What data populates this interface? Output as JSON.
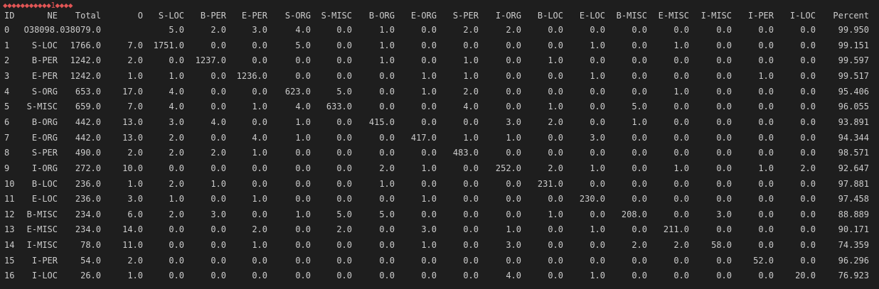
{
  "terminal": {
    "garbled_line": "◆◆◆◆◆◆◆◆◆◆◆1◆◆◆◆",
    "headers": [
      "ID",
      "NE",
      "Total",
      "O",
      "S-LOC",
      "B-PER",
      "E-PER",
      "S-ORG",
      "S-MISC",
      "B-ORG",
      "E-ORG",
      "S-PER",
      "I-ORG",
      "B-LOC",
      "E-LOC",
      "B-MISC",
      "E-MISC",
      "I-MISC",
      "I-PER",
      "I-LOC",
      "Percent"
    ],
    "rows": [
      [
        "0",
        "",
        "O38098.038079.0",
        "",
        "5.0",
        "2.0",
        "3.0",
        "4.0",
        "0.0",
        "1.0",
        "0.0",
        "2.0",
        "2.0",
        "0.0",
        "0.0",
        "0.0",
        "0.0",
        "0.0",
        "0.0",
        "0.0",
        "99.950"
      ],
      [
        "1",
        "S-LOC",
        "1766.0",
        "7.0",
        "1751.0",
        "0.0",
        "0.0",
        "5.0",
        "0.0",
        "1.0",
        "0.0",
        "0.0",
        "0.0",
        "0.0",
        "1.0",
        "0.0",
        "1.0",
        "0.0",
        "0.0",
        "0.0",
        "99.151"
      ],
      [
        "2",
        "B-PER",
        "1242.0",
        "2.0",
        "0.0",
        "1237.0",
        "0.0",
        "0.0",
        "0.0",
        "1.0",
        "0.0",
        "1.0",
        "0.0",
        "1.0",
        "0.0",
        "0.0",
        "0.0",
        "0.0",
        "0.0",
        "0.0",
        "99.597"
      ],
      [
        "3",
        "E-PER",
        "1242.0",
        "1.0",
        "1.0",
        "0.0",
        "1236.0",
        "0.0",
        "0.0",
        "0.0",
        "1.0",
        "1.0",
        "0.0",
        "0.0",
        "1.0",
        "0.0",
        "0.0",
        "0.0",
        "1.0",
        "0.0",
        "99.517"
      ],
      [
        "4",
        "S-ORG",
        "653.0",
        "17.0",
        "4.0",
        "0.0",
        "0.0",
        "623.0",
        "5.0",
        "0.0",
        "1.0",
        "2.0",
        "0.0",
        "0.0",
        "0.0",
        "0.0",
        "1.0",
        "0.0",
        "0.0",
        "0.0",
        "95.406"
      ],
      [
        "5",
        "S-MISC",
        "659.0",
        "7.0",
        "4.0",
        "0.0",
        "1.0",
        "4.0",
        "633.0",
        "0.0",
        "0.0",
        "4.0",
        "0.0",
        "1.0",
        "0.0",
        "5.0",
        "0.0",
        "0.0",
        "0.0",
        "0.0",
        "96.055"
      ],
      [
        "6",
        "B-ORG",
        "442.0",
        "13.0",
        "3.0",
        "4.0",
        "0.0",
        "1.0",
        "0.0",
        "415.0",
        "0.0",
        "0.0",
        "3.0",
        "2.0",
        "0.0",
        "1.0",
        "0.0",
        "0.0",
        "0.0",
        "0.0",
        "93.891"
      ],
      [
        "7",
        "E-ORG",
        "442.0",
        "13.0",
        "2.0",
        "0.0",
        "4.0",
        "1.0",
        "0.0",
        "0.0",
        "417.0",
        "1.0",
        "1.0",
        "0.0",
        "3.0",
        "0.0",
        "0.0",
        "0.0",
        "0.0",
        "0.0",
        "94.344"
      ],
      [
        "8",
        "S-PER",
        "490.0",
        "2.0",
        "2.0",
        "2.0",
        "1.0",
        "0.0",
        "0.0",
        "0.0",
        "0.0",
        "483.0",
        "0.0",
        "0.0",
        "0.0",
        "0.0",
        "0.0",
        "0.0",
        "0.0",
        "0.0",
        "98.571"
      ],
      [
        "9",
        "I-ORG",
        "272.0",
        "10.0",
        "0.0",
        "0.0",
        "0.0",
        "0.0",
        "0.0",
        "2.0",
        "1.0",
        "0.0",
        "252.0",
        "2.0",
        "1.0",
        "0.0",
        "1.0",
        "0.0",
        "1.0",
        "2.0",
        "92.647"
      ],
      [
        "10",
        "B-LOC",
        "236.0",
        "1.0",
        "2.0",
        "1.0",
        "0.0",
        "0.0",
        "0.0",
        "1.0",
        "0.0",
        "0.0",
        "0.0",
        "231.0",
        "0.0",
        "0.0",
        "0.0",
        "0.0",
        "0.0",
        "0.0",
        "97.881"
      ],
      [
        "11",
        "E-LOC",
        "236.0",
        "3.0",
        "1.0",
        "0.0",
        "1.0",
        "0.0",
        "0.0",
        "0.0",
        "1.0",
        "0.0",
        "0.0",
        "0.0",
        "230.0",
        "0.0",
        "0.0",
        "0.0",
        "0.0",
        "0.0",
        "97.458"
      ],
      [
        "12",
        "B-MISC",
        "234.0",
        "6.0",
        "2.0",
        "3.0",
        "0.0",
        "1.0",
        "5.0",
        "5.0",
        "0.0",
        "0.0",
        "0.0",
        "1.0",
        "0.0",
        "208.0",
        "0.0",
        "3.0",
        "0.0",
        "0.0",
        "88.889"
      ],
      [
        "13",
        "E-MISC",
        "234.0",
        "14.0",
        "0.0",
        "0.0",
        "2.0",
        "0.0",
        "2.0",
        "0.0",
        "3.0",
        "0.0",
        "1.0",
        "0.0",
        "1.0",
        "0.0",
        "211.0",
        "0.0",
        "0.0",
        "0.0",
        "90.171"
      ],
      [
        "14",
        "I-MISC",
        "78.0",
        "11.0",
        "0.0",
        "0.0",
        "1.0",
        "0.0",
        "0.0",
        "0.0",
        "1.0",
        "0.0",
        "3.0",
        "0.0",
        "0.0",
        "2.0",
        "2.0",
        "58.0",
        "0.0",
        "0.0",
        "74.359"
      ],
      [
        "15",
        "I-PER",
        "54.0",
        "2.0",
        "0.0",
        "0.0",
        "0.0",
        "0.0",
        "0.0",
        "0.0",
        "0.0",
        "0.0",
        "0.0",
        "0.0",
        "0.0",
        "0.0",
        "0.0",
        "0.0",
        "52.0",
        "0.0",
        "96.296"
      ],
      [
        "16",
        "I-LOC",
        "26.0",
        "1.0",
        "0.0",
        "0.0",
        "0.0",
        "0.0",
        "0.0",
        "0.0",
        "0.0",
        "0.0",
        "4.0",
        "0.0",
        "1.0",
        "0.0",
        "0.0",
        "0.0",
        "0.0",
        "20.0",
        "76.923"
      ]
    ]
  }
}
